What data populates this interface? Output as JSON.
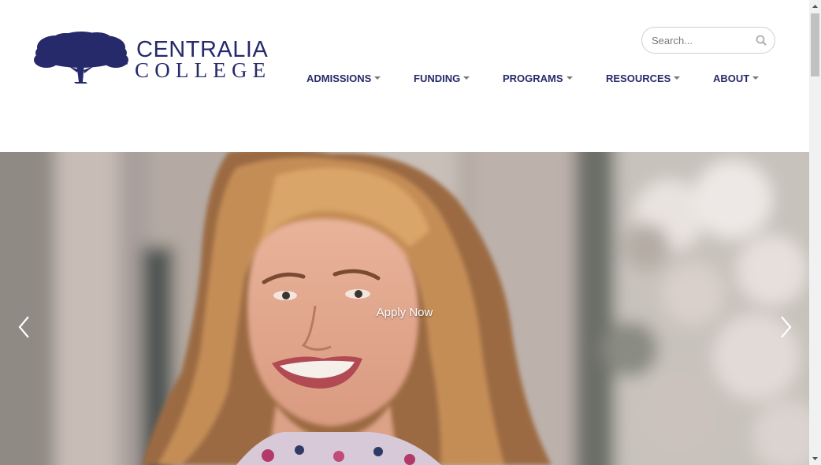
{
  "brand": {
    "name_line1": "CENTRALIA",
    "name_line2": "COLLEGE",
    "color": "#262a6b"
  },
  "search": {
    "placeholder": "Search...",
    "icon": "search-icon"
  },
  "nav": {
    "items": [
      {
        "label": "ADMISSIONS"
      },
      {
        "label": "FUNDING"
      },
      {
        "label": "PROGRAMS"
      },
      {
        "label": "RESOURCES"
      },
      {
        "label": "ABOUT"
      }
    ],
    "caret_icon": "caret-down-icon"
  },
  "hero": {
    "caption": "Apply Now",
    "prev_icon": "chevron-left-icon",
    "next_icon": "chevron-right-icon"
  },
  "scrollbar": {
    "up_icon": "arrow-up-icon",
    "down_icon": "arrow-down-icon"
  }
}
